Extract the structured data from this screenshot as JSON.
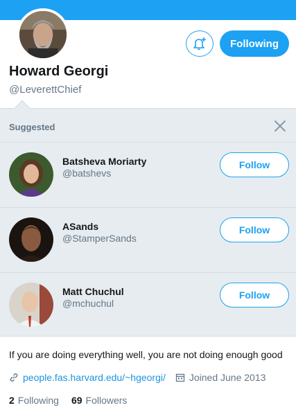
{
  "profile": {
    "name": "Howard Georgi",
    "handle": "@LeverettChief",
    "bio": "If you are doing everything well, you are not doing enough good",
    "website": "people.fas.harvard.edu/~hgeorgi/",
    "joined": "Joined June 2013",
    "following_count": "2",
    "following_label": "Following",
    "followers_count": "69",
    "followers_label": "Followers"
  },
  "actions": {
    "notifications_icon": "bell-plus-icon",
    "following_button": "Following"
  },
  "suggested": {
    "title": "Suggested",
    "close_icon": "close-icon",
    "users": [
      {
        "name": "Batsheva Moriarty",
        "handle": "@batshevs",
        "button": "Follow"
      },
      {
        "name": "ASands",
        "handle": "@StamperSands",
        "button": "Follow"
      },
      {
        "name": "Matt Chuchul",
        "handle": "@mchuchul",
        "button": "Follow"
      }
    ]
  },
  "colors": {
    "accent": "#1da1f2",
    "link": "#1b95e0",
    "secondary_text": "#657786",
    "panel_bg": "#e6ecf0"
  }
}
